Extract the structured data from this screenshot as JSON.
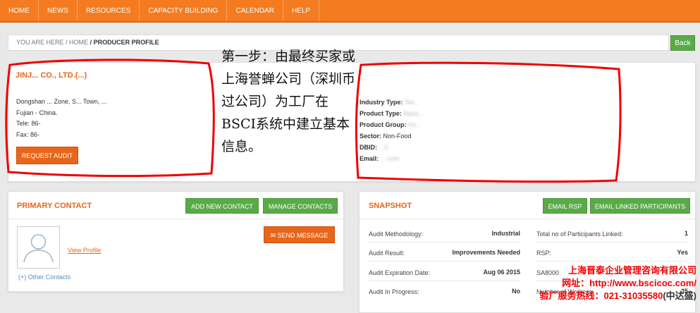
{
  "nav": {
    "items": [
      "HOME",
      "NEWS",
      "RESOURCES",
      "CAPACITY BUILDING",
      "CALENDAR",
      "HELP"
    ]
  },
  "breadcrumb": {
    "you_are_here": "YOU ARE HERE",
    "home": "/ HOME",
    "current": "/ PRODUCER PROFILE"
  },
  "back_label": "Back",
  "producer": {
    "name": "JINJ... CO., LTD.(...)",
    "address_lines": [
      "Dongshan ... Zone, S... Town, ...",
      "Fujian - China.",
      "Tele: 86-",
      "Fax: 86-"
    ],
    "request_audit": "REQUEST AUDIT",
    "info": [
      {
        "label": "Industry Type:",
        "value": "Tex..."
      },
      {
        "label": "Product Type:",
        "value": "Appa..."
      },
      {
        "label": "Product Group:",
        "value": "Ho..."
      },
      {
        "label": "Sector:",
        "value": "Non-Food"
      },
      {
        "label": "DBID:",
        "value": "...3"
      },
      {
        "label": "Email:",
        "value": "....com"
      }
    ]
  },
  "annotation_text": "第一步：由最终买家或上海誉蝉公司（深圳币过公司）为工厂在BSCI系统中建立基本信息。",
  "primary_contact": {
    "title": "PRIMARY CONTACT",
    "add_new": "ADD NEW CONTACT",
    "manage": "MANAGE CONTACTS",
    "view_profile": "View Profile",
    "send_message": "SEND MESSAGE",
    "other_contacts": "(+) Other Contacts"
  },
  "snapshot": {
    "title": "SNAPSHOT",
    "email_rsp": "EMAIL RSP",
    "email_linked": "EMAIL LINKED PARTICIPANTS",
    "left": [
      {
        "label": "Audit Methodology:",
        "value": "Industrial"
      },
      {
        "label": "Audit Result:",
        "value": "Improvements Needed"
      },
      {
        "label": "Audit Expiration Date:",
        "value": "Aug 06 2015"
      },
      {
        "label": "Audit In Progress:",
        "value": "No"
      }
    ],
    "right": [
      {
        "label": "Total no of Participants Linked:",
        "value": "1"
      },
      {
        "label": "RSP:",
        "value": "Yes"
      },
      {
        "label": "SA8000",
        "value": ""
      },
      {
        "label": "Number of Workers:",
        "value": "35"
      }
    ]
  },
  "watermark": {
    "line1": "上海晋泰企业管理咨询有限公司",
    "line2": "网址：http://www.bscicoc.com/",
    "line3": "验厂服务热线：021-31035580",
    "tail": "(中达盛)"
  },
  "colors": {
    "orange": "#f47b20",
    "green": "#5aab47",
    "annotation_red": "#e00000"
  }
}
